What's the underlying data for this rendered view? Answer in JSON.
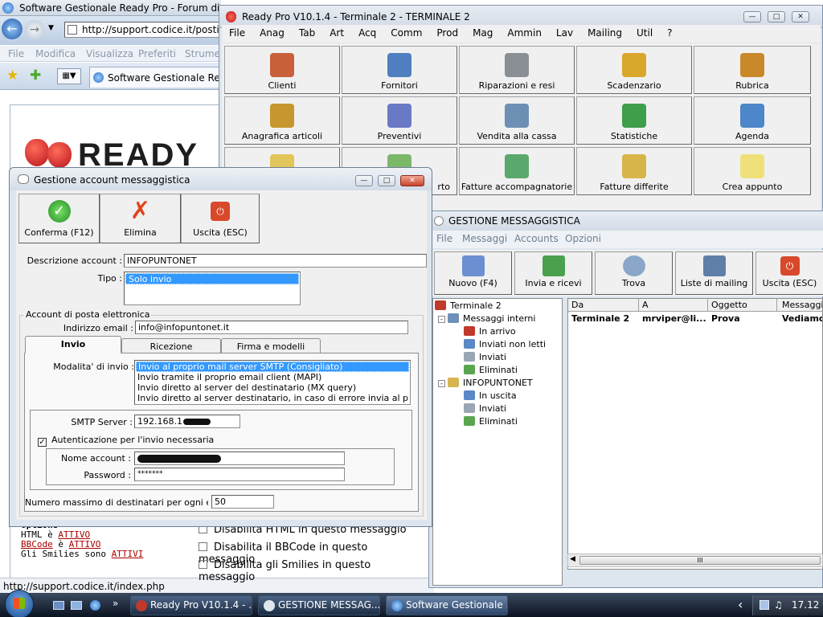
{
  "browser": {
    "title": "Software Gestionale Ready Pro - Forum di sup",
    "address": "http://support.codice.it/postin",
    "menu": [
      "File",
      "Modifica",
      "Visualizza",
      "Preferiti",
      "Strume"
    ],
    "tab_title": "Software Gestionale Re...",
    "logo_text": "READY",
    "status_url": "http://support.codice.it/index.php",
    "options_heading": "Options",
    "options": [
      {
        "text": "HTML è ",
        "link": "ATTIVO"
      },
      {
        "text": "BBCode",
        "link_pre": true,
        "mid": " è ",
        "link": "ATTIVO"
      },
      {
        "text": "Gli Smilies sono ",
        "link": "ATTIVI"
      }
    ],
    "checks": [
      "Disabilita HTML in questo messaggio",
      "Disabilita il BBCode in questo messaggio",
      "Disabilita gli Smilies in questo messaggio"
    ]
  },
  "readypro": {
    "title": "Ready Pro V10.1.4 - Terminale 2 - TERMINALE 2",
    "menu": [
      "File",
      "Anag",
      "Tab",
      "Art",
      "Acq",
      "Comm",
      "Prod",
      "Mag",
      "Ammin",
      "Lav",
      "Mailing",
      "Util",
      "?"
    ],
    "tiles": [
      {
        "label": "Clienti",
        "color": "#c8603a"
      },
      {
        "label": "Fornitori",
        "color": "#4f7fbf"
      },
      {
        "label": "Riparazioni e resi",
        "color": "#8a8f96"
      },
      {
        "label": "Scadenzario",
        "color": "#d9a72c"
      },
      {
        "label": "Rubrica",
        "color": "#c9882a"
      },
      {
        "label": "Anagrafica articoli",
        "color": "#c8962e"
      },
      {
        "label": "Preventivi",
        "color": "#6a79c6"
      },
      {
        "label": "Vendita alla cassa",
        "color": "#6d8fb3"
      },
      {
        "label": "Statistiche",
        "color": "#3f9e4a"
      },
      {
        "label": "Agenda",
        "color": "#4d86c9"
      },
      {
        "label": "",
        "color": "#e2c55a"
      },
      {
        "label": "rto",
        "color": "#7cb86a"
      },
      {
        "label": "Fatture accompagnatorie",
        "color": "#5aa86b"
      },
      {
        "label": "Fatture differite",
        "color": "#d8b54a"
      },
      {
        "label": "Crea appunto",
        "color": "#f0e07a"
      }
    ]
  },
  "messaging": {
    "title": "GESTIONE MESSAGGISTICA",
    "menu": [
      "File",
      "Messaggi",
      "Accounts",
      "Opzioni"
    ],
    "toolbar": [
      {
        "label": "Nuovo (F4)",
        "color": "#6b8fd0"
      },
      {
        "label": "Invia e ricevi",
        "color": "#4aa04d"
      },
      {
        "label": "Trova",
        "color": "#8aa6c8"
      },
      {
        "label": "Liste di mailing",
        "color": "#5f7fa8"
      },
      {
        "label": "Uscita (ESC)",
        "color": "#d8492b"
      }
    ],
    "tree": [
      {
        "label": "Terminale 2",
        "level": 0,
        "color": "#c0392b"
      },
      {
        "label": "Messaggi interni",
        "level": 1,
        "color": "#6f8fb8"
      },
      {
        "label": "In arrivo",
        "level": 2,
        "color": "#c0392b"
      },
      {
        "label": "Inviati non letti",
        "level": 2,
        "color": "#5b88c7"
      },
      {
        "label": "Inviati",
        "level": 2,
        "color": "#9aa6b3"
      },
      {
        "label": "Eliminati",
        "level": 2,
        "color": "#5aa64f"
      },
      {
        "label": "INFOPUNTONET",
        "level": 1,
        "color": "#d7b552"
      },
      {
        "label": "In uscita",
        "level": 2,
        "color": "#5b88c7"
      },
      {
        "label": "Inviati",
        "level": 2,
        "color": "#9aa6b3"
      },
      {
        "label": "Eliminati",
        "level": 2,
        "color": "#5aa64f"
      }
    ],
    "columns": [
      "Da",
      "A",
      "Oggetto",
      "Messaggi"
    ],
    "rows": [
      {
        "da": "Terminale 2",
        "a": "mrviper@li...",
        "oggetto": "Prova",
        "messaggio": "Vediamo"
      }
    ],
    "scroll_thumb": "III"
  },
  "account_dialog": {
    "title": "Gestione account messaggistica",
    "buttons": {
      "confirm": "Conferma (F12)",
      "delete": "Elimina",
      "exit": "Uscita (ESC)"
    },
    "descrizione_label": "Descrizione account :",
    "descrizione_value": "INFOPUNTONET",
    "tipo_label": "Tipo :",
    "tipo_value": "Solo invio",
    "email_group": "Account di posta elettronica",
    "email_label": "Indirizzo email :",
    "email_value": "info@infopuntonet.it",
    "tabs": [
      "Invio",
      "Ricezione",
      "Firma e modelli"
    ],
    "modalita_label": "Modalita' di invio :",
    "modalita_options": [
      "Invio al proprio mail server SMTP (Consigliato)",
      "Invio tramite il proprio email client (MAPI)",
      "Invio diretto al server del destinatario (MX query)",
      "Invio diretto al server destinatario, in caso di errore invia al proprio SMTF"
    ],
    "smtp_label": "SMTP Server :",
    "smtp_value": "192.168.1",
    "auth_label": "Autenticazione per l'invio necessaria",
    "nome_label": "Nome account :",
    "password_label": "Password :",
    "password_value": "*******",
    "max_label": "Numero massimo di destinatari per ogni email :",
    "max_value": "50"
  },
  "taskbar": {
    "items": [
      {
        "label": "Ready Pro V10.1.4 - ...",
        "color": "#c0392b"
      },
      {
        "label": "GESTIONE MESSAG...",
        "color": "#dfe6ee"
      },
      {
        "label": "Software Gestionale ...",
        "color": "#3b7fd1"
      }
    ],
    "chevron": "»",
    "tray_chevron": "‹",
    "clock": "17.12"
  }
}
